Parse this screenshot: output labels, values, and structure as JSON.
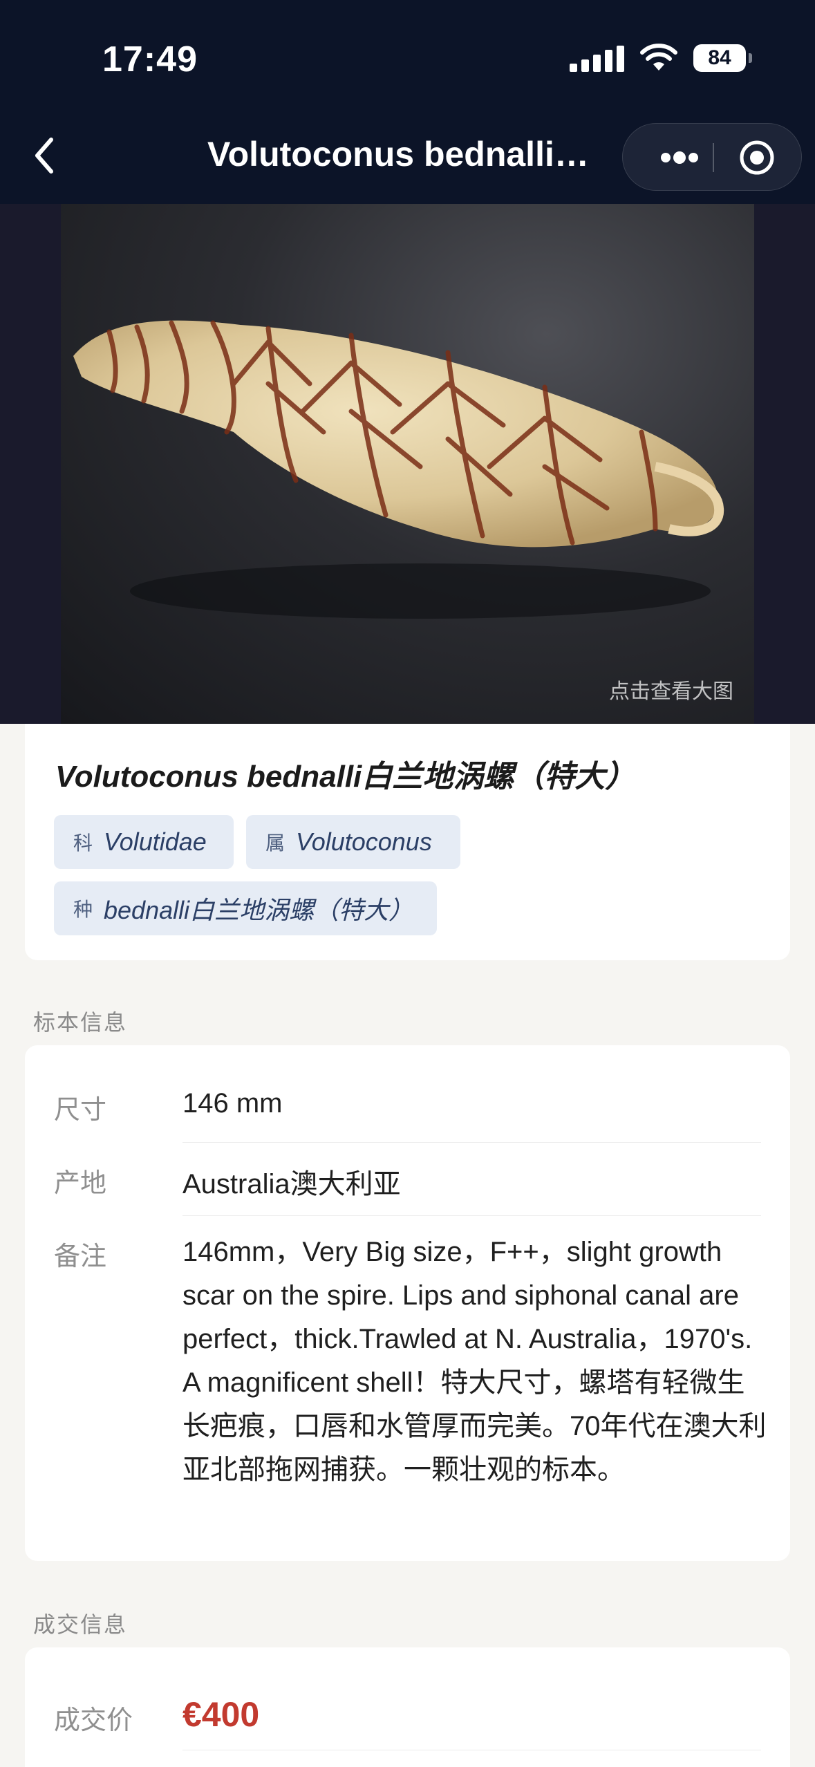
{
  "status_bar": {
    "time": "17:49",
    "battery": "84",
    "icons": [
      "cellular-signal-icon",
      "wifi-icon",
      "battery-icon"
    ]
  },
  "nav": {
    "title": "Volutoconus bednalli…",
    "back_icon": "chevron-left-icon",
    "more_icon": "more-dots-icon",
    "close_icon": "target-circle-icon"
  },
  "photo": {
    "hint": "点击查看大图"
  },
  "specimen": {
    "title": "Volutoconus bednalli白兰地涡螺（特大）",
    "tags": [
      {
        "prefix": "科",
        "value": "Volutidae"
      },
      {
        "prefix": "属",
        "value": "Volutoconus"
      },
      {
        "prefix": "种",
        "value": "bednalli白兰地涡螺（特大）"
      }
    ]
  },
  "specimen_info": {
    "section_label": "标本信息",
    "rows": [
      {
        "label": "尺寸",
        "value": "146 mm"
      },
      {
        "label": "产地",
        "value": "Australia澳大利亚"
      },
      {
        "label": "备注",
        "value": "146mm，Very Big size，F++，slight growth scar on the spire. Lips and siphonal canal are perfect，thick.Trawled at N. Australia，1970's. A magnificent shell！特大尺寸，螺塔有轻微生长疤痕，口唇和水管厚而完美。70年代在澳大利亚北部拖网捕获。一颗壮观的标本。"
      }
    ]
  },
  "deal_info": {
    "section_label": "成交信息",
    "price_label": "成交价",
    "price_value": "€400"
  },
  "colors": {
    "header_bg": "#0c1428",
    "page_bg": "#f6f5f2",
    "tag_bg": "#e6ecf5",
    "price": "#c23a2f"
  }
}
